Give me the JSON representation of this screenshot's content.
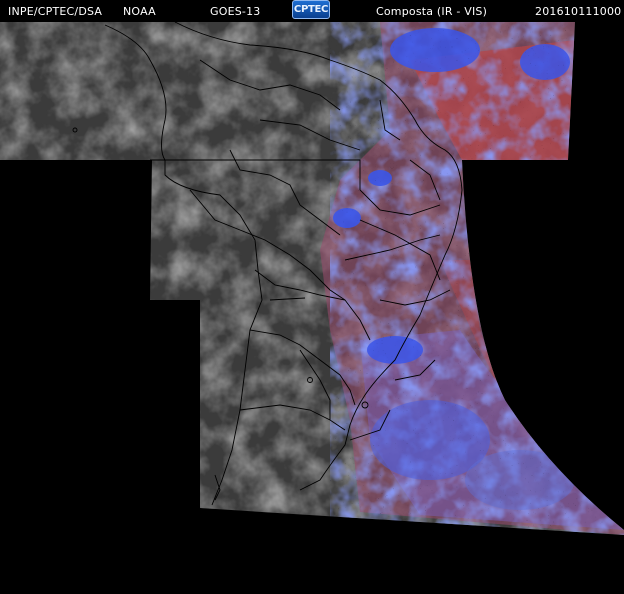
{
  "header": {
    "agency": "INPE/CPTEC/DSA",
    "partner": "NOAA",
    "satellite": "GOES-13",
    "logo_text": "CPTEC",
    "product": "Composta (IR - VIS)",
    "timestamp": "201610111000"
  },
  "colors": {
    "background": "#000000",
    "cloud_gray": "#5e5e5e",
    "land_dark": "#3a3a3a",
    "ir_blue": "#3b55e8",
    "ir_red": "#b4454a",
    "ir_purple": "#7a5fb4",
    "borders": "#000000"
  },
  "icons": [
    "cptec-logo-icon"
  ]
}
